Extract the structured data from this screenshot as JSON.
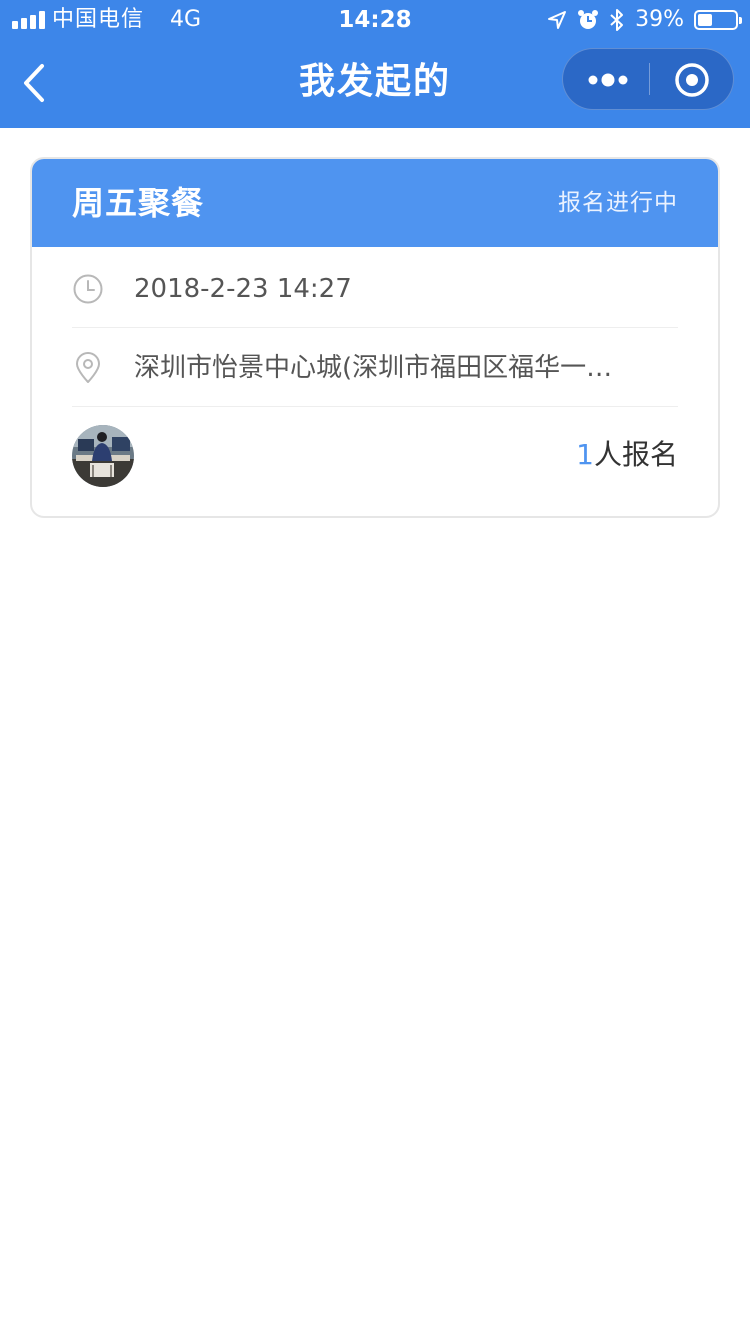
{
  "status_bar": {
    "carrier": "中国电信",
    "network": "4G",
    "time": "14:28",
    "battery_percent": "39%",
    "battery_level": 0.39
  },
  "nav": {
    "title": "我发起的",
    "back_icon": "chevron-left-icon",
    "more_icon": "more-dots-icon",
    "close_icon": "target-circle-icon"
  },
  "event": {
    "title": "周五聚餐",
    "status": "报名进行中",
    "datetime": "2018-2-23 14:27",
    "location": "深圳市怡景中心城(深圳市福田区福华一…",
    "signup_count": "1",
    "signup_suffix": "人报名"
  },
  "colors": {
    "header_bg": "#3d86e9",
    "card_head_bg": "#4f94f0",
    "accent": "#4f94f0"
  }
}
